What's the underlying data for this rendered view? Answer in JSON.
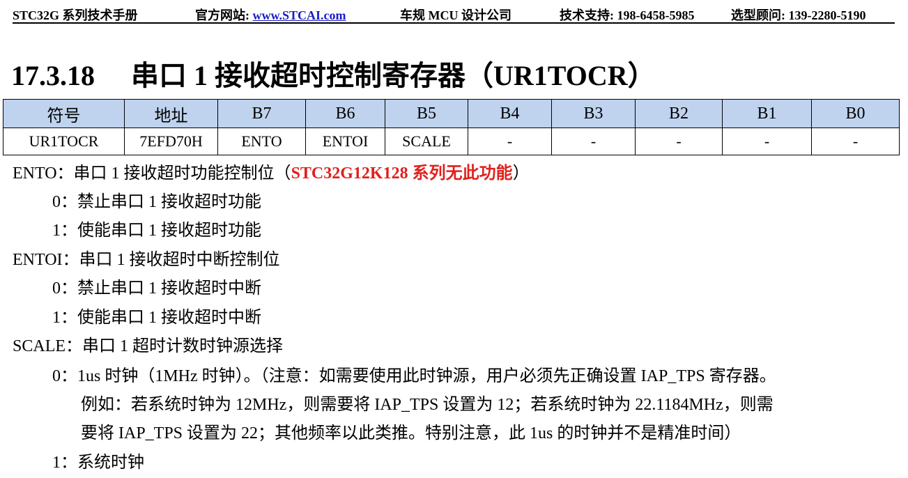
{
  "header": {
    "doc_title": "STC32G 系列技术手册",
    "site_label": "官方网站:",
    "site_url": "www.STCAI.com",
    "company": "车规 MCU 设计公司",
    "support": "技术支持: 198-6458-5985",
    "consult": "选型顾问: 139-2280-5190"
  },
  "section": {
    "number": "17.3.18",
    "title": "串口 1 接收超时控制寄存器（UR1TOCR）"
  },
  "register_table": {
    "headers": [
      "符号",
      "地址",
      "B7",
      "B6",
      "B5",
      "B4",
      "B3",
      "B2",
      "B1",
      "B0"
    ],
    "row": [
      "UR1TOCR",
      "7EFD70H",
      "ENTO",
      "ENTOI",
      "SCALE",
      "-",
      "-",
      "-",
      "-",
      "-"
    ]
  },
  "fields": {
    "ento": {
      "desc": "ENTO：串口 1 接收超时功能控制位（",
      "warning": "STC32G12K128 系列无此功能",
      "desc_end": "）",
      "opt0": "0：禁止串口 1 接收超时功能",
      "opt1": "1：使能串口 1 接收超时功能"
    },
    "entoi": {
      "desc": "ENTOI：串口 1 接收超时中断控制位",
      "opt0": "0：禁止串口 1 接收超时中断",
      "opt1": "1：使能串口 1 接收超时中断"
    },
    "scale": {
      "desc": "SCALE：串口 1 超时计数时钟源选择",
      "opt0_line1": "0：1us 时钟（1MHz 时钟）。（注意：如需要使用此时钟源，用户必须先正确设置 IAP_TPS 寄存器。",
      "opt0_line2": "例如：若系统时钟为 12MHz，则需要将 IAP_TPS 设置为 12；若系统时钟为 22.1184MHz，则需",
      "opt0_line3": "要将 IAP_TPS 设置为 22；其他频率以此类推。特别注意，此 1us 的时钟并不是精准时间）",
      "opt1": "1：系统时钟"
    }
  }
}
